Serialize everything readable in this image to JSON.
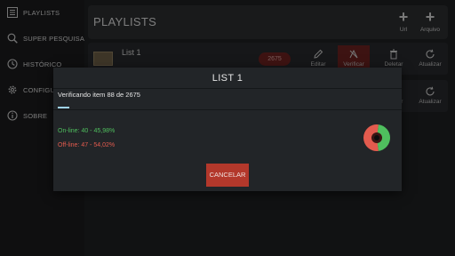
{
  "sidebar": {
    "items": [
      {
        "label": "PLAYLISTS",
        "icon": "list-icon"
      },
      {
        "label": "SUPER PESQUISA",
        "icon": "search-icon"
      },
      {
        "label": "HISTÓRICO",
        "icon": "history-icon"
      },
      {
        "label": "CONFIGURAÇÕES",
        "icon": "gear-icon"
      },
      {
        "label": "SOBRE",
        "icon": "info-icon"
      }
    ]
  },
  "header": {
    "title": "PLAYLISTS",
    "url_label": "Url",
    "file_label": "Arquivo"
  },
  "playlists": [
    {
      "title": "List 1",
      "count": "2675",
      "actions": {
        "edit": "Editar",
        "verify": "Verificar",
        "delete": "Deletar",
        "update": "Atualizar"
      }
    },
    {
      "actions": {
        "delete": "Deletar",
        "update": "Atualizar"
      }
    }
  ],
  "dialog": {
    "title": "LIST 1",
    "status": "Verificando item 88 de 2675",
    "progress": 0.033,
    "online_text": "On-line: 40 - 45,98%",
    "offline_text": "Off-line: 47 - 54,02%",
    "online_fraction": 0.4598,
    "offline_fraction": 0.5402,
    "cancel_label": "CANCELAR"
  },
  "colors": {
    "online": "#4fbf5e",
    "offline": "#e35b4e",
    "accent_red": "#b3382b",
    "progress": "#9fd3ea"
  }
}
